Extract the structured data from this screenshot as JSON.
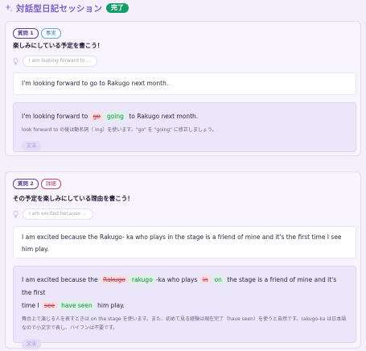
{
  "header": {
    "title": "対話型日記セッション",
    "status_badge": "完了"
  },
  "colors": {
    "accent": "#7b5fc4",
    "done": "#169c6a",
    "deleted": "#c23a4c",
    "inserted": "#1b8a4f"
  },
  "questions": [
    {
      "number_tag": "質問 1",
      "type_tag": "事実",
      "question": "楽しみにしている予定を書こう！",
      "hint": "I am looking forward to ...",
      "answer": "I'm looking forward to go to Rakugo next month.",
      "correction": {
        "seg1": "I'm looking forward to",
        "del1": "go",
        "ins1": "going",
        "seg2": "to Rakugo next month."
      },
      "explanation": "look forward to の後は動名詞（ ing）を使います。\"go\" を \"going\" に修正しましょう。",
      "button": "文法"
    },
    {
      "number_tag": "質問 2",
      "type_tag": "詳細",
      "question": "その予定を楽しみにしている理由を書こう！",
      "hint": "I am excited because ...",
      "answer": "I am excited because the Rakugo- ka who plays in the stage is a friend of mine and it's the first time I see him play.",
      "correction": {
        "seg1": "I am excited because the",
        "del1": "Rakugo",
        "ins1": "rakugo",
        "seg2": "-ka who plays",
        "del2": "in",
        "ins2": "on",
        "seg3": "the stage is a friend of mine and it's the first",
        "seg4": "time I",
        "del3": "see",
        "ins3": "have seen",
        "seg5": "him play."
      },
      "explanation": "舞台上で演じる人を表すときは on the stage を使います。また、初めて見る経験は現在完了（have seen）を使うと自然です。rakugo-ka は日本語なので小文字で表し、ハイフンは不要です。",
      "button": "文法"
    }
  ]
}
